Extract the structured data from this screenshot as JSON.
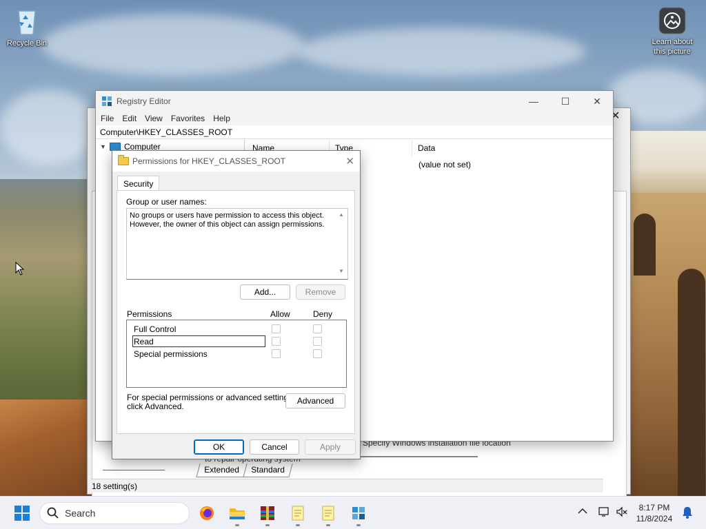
{
  "desktop": {
    "recycle_bin_label": "Recycle Bin",
    "learn_label_line1": "Learn about",
    "learn_label_line2": "this picture"
  },
  "background_window": {
    "status_text": "18 setting(s)",
    "tab_extended": "Extended",
    "tab_standard": "Standard",
    "row_text_1": "Specify Windows installation file location",
    "row_text_2": "to repair operating system"
  },
  "regedit": {
    "title": "Registry Editor",
    "menu": [
      "File",
      "Edit",
      "View",
      "Favorites",
      "Help"
    ],
    "address": "Computer\\HKEY_CLASSES_ROOT",
    "tree_root": "Computer",
    "columns": {
      "name": "Name",
      "type": "Type",
      "data": "Data"
    },
    "default_value_data": "(value not set)",
    "minimize_glyph": "—",
    "maximize_glyph": "☐",
    "close_glyph": "✕"
  },
  "permissions_dialog": {
    "title": "Permissions for HKEY_CLASSES_ROOT",
    "tab_security": "Security",
    "groups_label": "Group or user names:",
    "groups_message_line1": "No groups or users have permission to access this object.",
    "groups_message_line2": "However, the owner of this object can assign permissions.",
    "add_button": "Add...",
    "remove_button": "Remove",
    "permissions_label": "Permissions",
    "allow_label": "Allow",
    "deny_label": "Deny",
    "permissions": [
      {
        "name": "Full Control",
        "allow": false,
        "deny": false
      },
      {
        "name": "Read",
        "allow": false,
        "deny": false
      },
      {
        "name": "Special permissions",
        "allow": false,
        "deny": false
      }
    ],
    "special_text_line1": "For special permissions or advanced settings,",
    "special_text_line2": "click Advanced.",
    "advanced_button": "Advanced",
    "ok_button": "OK",
    "cancel_button": "Cancel",
    "apply_button": "Apply",
    "close_glyph": "✕"
  },
  "taskbar": {
    "search_placeholder": "Search",
    "apps": [
      "start-icon",
      "firefox-icon",
      "file-explorer-icon",
      "winrar-icon",
      "notepad-icon",
      "notepad-icon",
      "registry-editor-icon"
    ],
    "time": "8:17 PM",
    "date": "11/8/2024"
  },
  "colors": {
    "accent": "#0067c0",
    "taskbar_bg": "#eef0f5",
    "dialog_bg": "#f0f0f0"
  }
}
